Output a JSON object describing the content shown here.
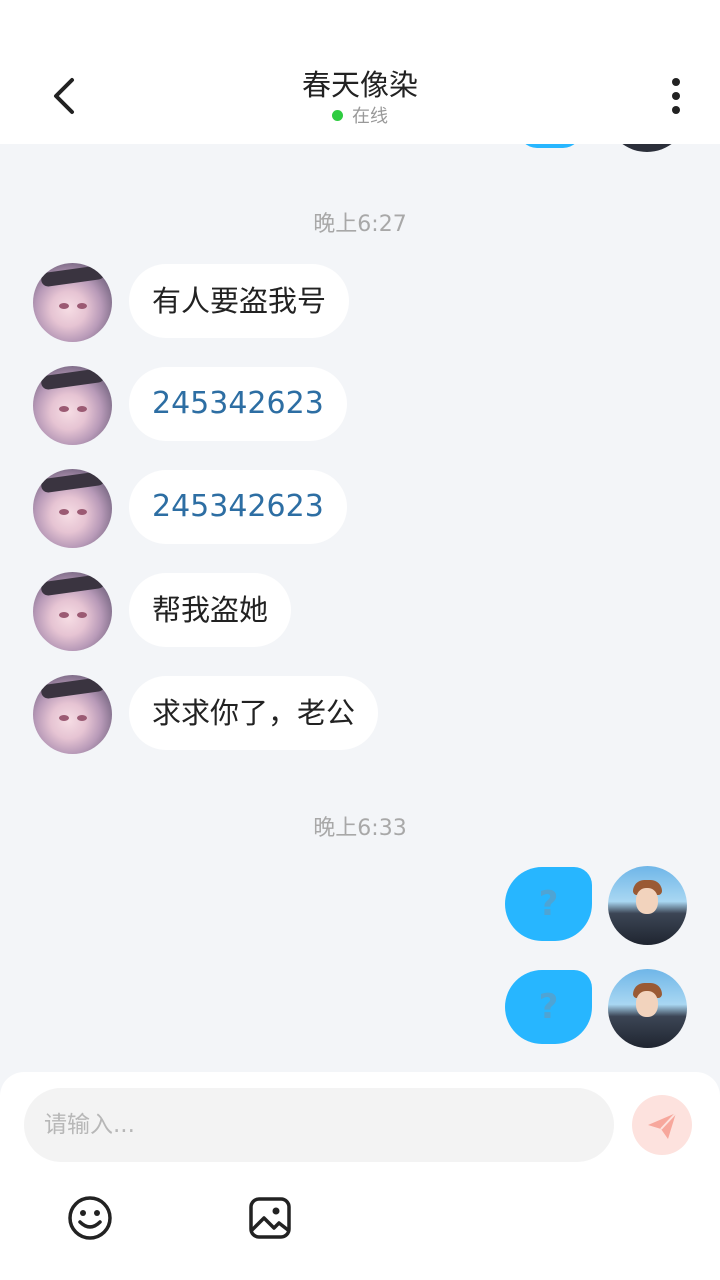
{
  "header": {
    "title": "春天像染",
    "status": "在线",
    "back_icon": "chevron-left-icon",
    "more_icon": "more-vertical-icon"
  },
  "messages": {
    "time_1": "晚上6:27",
    "her": [
      "有人要盗我号",
      "245342623",
      "245342623",
      "帮我盗她",
      "求求你了，老公"
    ],
    "time_2": "晚上6:33",
    "me": [
      "?",
      "?"
    ]
  },
  "composer": {
    "placeholder": "请输入...",
    "send_icon": "paper-plane-icon",
    "emoji_icon": "smiley-icon",
    "image_icon": "image-icon"
  },
  "colors": {
    "background": "#f3f5f8",
    "my_bubble": "#27b6ff",
    "online_dot": "#2ecc40",
    "link_number": "#2d6ea3",
    "send_button": "#fde2de"
  }
}
